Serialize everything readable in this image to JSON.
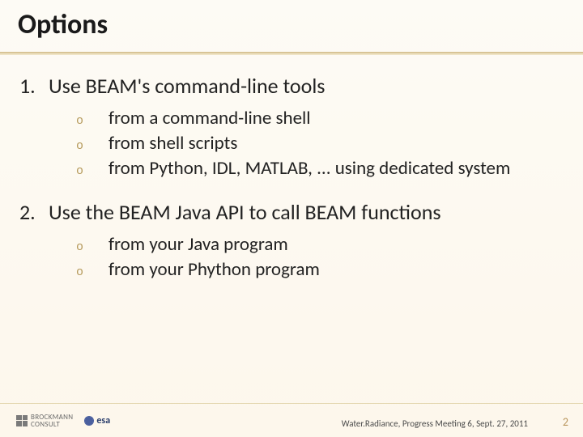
{
  "title": "Options",
  "list": {
    "items": [
      {
        "num": "1.",
        "text": "Use BEAM's command-line tools",
        "subs": [
          "from a command-line shell",
          "from shell scripts",
          "from Python, IDL, MATLAB, ... using dedicated system"
        ]
      },
      {
        "num": "2.",
        "text": "Use the BEAM Java API to call BEAM functions",
        "subs": [
          "from your Java program",
          "from your Phython program"
        ]
      }
    ]
  },
  "bullet_glyph": "o",
  "footer": {
    "logo_bc_top": "BROCKMANN",
    "logo_bc_bottom": "CONSULT",
    "logo_esa": "esa",
    "meta": "Water.Radiance, Progress Meeting 6,   Sept. 27, 2011",
    "page": "2"
  }
}
